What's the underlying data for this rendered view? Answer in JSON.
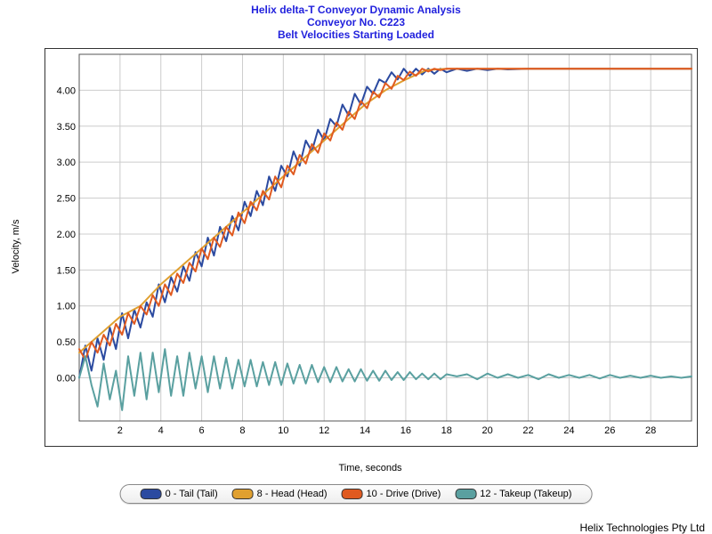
{
  "titles": {
    "line1": "Helix delta-T Conveyor Dynamic Analysis",
    "line2": "Conveyor No. C223",
    "line3": "Belt Velocities Starting Loaded"
  },
  "axis": {
    "x": "Time, seconds",
    "y": "Velocity, m/s"
  },
  "footer": "Helix Technologies Pty Ltd",
  "legend": [
    {
      "label": "0 - Tail (Tail)",
      "color": "#2b4aa0"
    },
    {
      "label": "8 - Head (Head)",
      "color": "#e0a030"
    },
    {
      "label": "10 - Drive (Drive)",
      "color": "#e05a20"
    },
    {
      "label": "12 - Takeup (Takeup)",
      "color": "#5aa0a0"
    }
  ],
  "chart_data": {
    "type": "line",
    "xlabel": "Time, seconds",
    "ylabel": "Velocity, m/s",
    "xlim": [
      0,
      30
    ],
    "ylim": [
      -0.6,
      4.5
    ],
    "x_ticks": [
      2,
      4,
      6,
      8,
      10,
      12,
      14,
      16,
      18,
      20,
      22,
      24,
      26,
      28
    ],
    "y_ticks": [
      0.0,
      0.5,
      1.0,
      1.5,
      2.0,
      2.5,
      3.0,
      3.5,
      4.0
    ],
    "series": [
      {
        "name": "0 - Tail (Tail)",
        "color": "#2b4aa0",
        "x": [
          0,
          0.3,
          0.6,
          0.9,
          1.2,
          1.5,
          1.8,
          2.1,
          2.4,
          2.7,
          3,
          3.3,
          3.6,
          3.9,
          4.2,
          4.5,
          4.8,
          5.1,
          5.4,
          5.7,
          6,
          6.3,
          6.6,
          6.9,
          7.2,
          7.5,
          7.8,
          8.1,
          8.4,
          8.7,
          9,
          9.3,
          9.6,
          9.9,
          10.2,
          10.5,
          10.8,
          11.1,
          11.4,
          11.7,
          12,
          12.3,
          12.6,
          12.9,
          13.2,
          13.5,
          13.8,
          14.1,
          14.4,
          14.7,
          15,
          15.3,
          15.6,
          15.9,
          16.2,
          16.5,
          16.8,
          17.1,
          17.4,
          17.7,
          18,
          18.5,
          19,
          19.5,
          20,
          20.5,
          21,
          22,
          23,
          24,
          25,
          26,
          27,
          28,
          29,
          30
        ],
        "y": [
          0.0,
          0.45,
          0.1,
          0.55,
          0.25,
          0.7,
          0.4,
          0.9,
          0.55,
          0.95,
          0.7,
          1.05,
          0.85,
          1.3,
          1.05,
          1.4,
          1.2,
          1.55,
          1.35,
          1.75,
          1.55,
          1.95,
          1.7,
          2.1,
          1.9,
          2.25,
          2.05,
          2.45,
          2.25,
          2.6,
          2.4,
          2.8,
          2.6,
          2.95,
          2.8,
          3.15,
          2.95,
          3.3,
          3.15,
          3.45,
          3.3,
          3.6,
          3.5,
          3.8,
          3.65,
          3.95,
          3.8,
          4.05,
          3.95,
          4.15,
          4.1,
          4.25,
          4.15,
          4.3,
          4.2,
          4.3,
          4.22,
          4.3,
          4.23,
          4.3,
          4.25,
          4.3,
          4.27,
          4.3,
          4.28,
          4.3,
          4.29,
          4.3,
          4.3,
          4.3,
          4.3,
          4.3,
          4.3,
          4.3,
          4.3,
          4.3
        ]
      },
      {
        "name": "8 - Head (Head)",
        "color": "#e0a030",
        "x": [
          0,
          1,
          2,
          3,
          4,
          5,
          6,
          7,
          8,
          9,
          10,
          11,
          12,
          13,
          14,
          15,
          16,
          17,
          18,
          20,
          22,
          24,
          26,
          28,
          30
        ],
        "y": [
          0.35,
          0.6,
          0.85,
          1.0,
          1.3,
          1.55,
          1.8,
          2.05,
          2.3,
          2.55,
          2.8,
          3.05,
          3.3,
          3.55,
          3.8,
          4.0,
          4.15,
          4.28,
          4.3,
          4.3,
          4.3,
          4.3,
          4.3,
          4.3,
          4.3
        ]
      },
      {
        "name": "10 - Drive (Drive)",
        "color": "#e05a20",
        "x": [
          0,
          0.3,
          0.6,
          0.9,
          1.2,
          1.5,
          1.8,
          2.1,
          2.4,
          2.7,
          3,
          3.3,
          3.6,
          3.9,
          4.2,
          4.5,
          4.8,
          5.1,
          5.4,
          5.7,
          6,
          6.3,
          6.6,
          6.9,
          7.2,
          7.5,
          7.8,
          8.1,
          8.4,
          8.7,
          9,
          9.3,
          9.6,
          9.9,
          10.2,
          10.5,
          10.8,
          11.1,
          11.4,
          11.7,
          12,
          12.3,
          12.6,
          12.9,
          13.2,
          13.5,
          13.8,
          14.1,
          14.4,
          14.7,
          15,
          15.3,
          15.6,
          15.9,
          16.2,
          16.5,
          16.8,
          17.1,
          17.4,
          17.7,
          18,
          19,
          20,
          21,
          22,
          23,
          24,
          25,
          26,
          27,
          28,
          29,
          30
        ],
        "y": [
          0.4,
          0.25,
          0.5,
          0.35,
          0.6,
          0.45,
          0.75,
          0.6,
          0.9,
          0.75,
          1.0,
          0.88,
          1.15,
          1.0,
          1.3,
          1.15,
          1.45,
          1.32,
          1.6,
          1.48,
          1.8,
          1.65,
          1.95,
          1.82,
          2.1,
          1.98,
          2.3,
          2.15,
          2.45,
          2.33,
          2.6,
          2.48,
          2.8,
          2.65,
          2.95,
          2.83,
          3.1,
          2.98,
          3.25,
          3.13,
          3.4,
          3.3,
          3.55,
          3.45,
          3.7,
          3.6,
          3.85,
          3.75,
          3.98,
          3.9,
          4.1,
          4.02,
          4.2,
          4.14,
          4.26,
          4.2,
          4.3,
          4.26,
          4.3,
          4.28,
          4.3,
          4.3,
          4.3,
          4.3,
          4.3,
          4.3,
          4.3,
          4.3,
          4.3,
          4.3,
          4.3,
          4.3,
          4.3
        ]
      },
      {
        "name": "12 - Takeup (Takeup)",
        "color": "#5aa0a0",
        "x": [
          0,
          0.3,
          0.6,
          0.9,
          1.2,
          1.5,
          1.8,
          2.1,
          2.4,
          2.7,
          3,
          3.3,
          3.6,
          3.9,
          4.2,
          4.5,
          4.8,
          5.1,
          5.4,
          5.7,
          6,
          6.3,
          6.6,
          6.9,
          7.2,
          7.5,
          7.8,
          8.1,
          8.4,
          8.7,
          9,
          9.3,
          9.6,
          9.9,
          10.2,
          10.5,
          10.8,
          11.1,
          11.4,
          11.7,
          12,
          12.3,
          12.6,
          12.9,
          13.2,
          13.5,
          13.8,
          14.1,
          14.4,
          14.7,
          15,
          15.3,
          15.6,
          15.9,
          16.2,
          16.5,
          16.8,
          17.1,
          17.4,
          17.7,
          18,
          18.5,
          19,
          19.5,
          20,
          20.5,
          21,
          21.5,
          22,
          22.5,
          23,
          23.5,
          24,
          24.5,
          25,
          25.5,
          26,
          26.5,
          27,
          27.5,
          28,
          28.5,
          29,
          29.5,
          30
        ],
        "y": [
          0.0,
          0.3,
          -0.1,
          -0.4,
          0.2,
          -0.3,
          0.1,
          -0.45,
          0.3,
          -0.25,
          0.35,
          -0.3,
          0.35,
          -0.2,
          0.4,
          -0.25,
          0.3,
          -0.25,
          0.35,
          -0.15,
          0.3,
          -0.2,
          0.3,
          -0.15,
          0.28,
          -0.15,
          0.25,
          -0.12,
          0.25,
          -0.12,
          0.22,
          -0.1,
          0.22,
          -0.1,
          0.2,
          -0.08,
          0.18,
          -0.08,
          0.18,
          -0.06,
          0.15,
          -0.06,
          0.15,
          -0.05,
          0.12,
          -0.05,
          0.12,
          -0.04,
          0.1,
          -0.04,
          0.1,
          -0.03,
          0.08,
          -0.03,
          0.08,
          -0.02,
          0.06,
          -0.02,
          0.06,
          -0.02,
          0.05,
          0.02,
          0.05,
          -0.02,
          0.06,
          0.0,
          0.05,
          0.0,
          0.04,
          -0.02,
          0.05,
          0.0,
          0.04,
          0.0,
          0.04,
          -0.01,
          0.04,
          0.0,
          0.03,
          0.0,
          0.03,
          0.0,
          0.02,
          0.0,
          0.02
        ]
      }
    ]
  }
}
